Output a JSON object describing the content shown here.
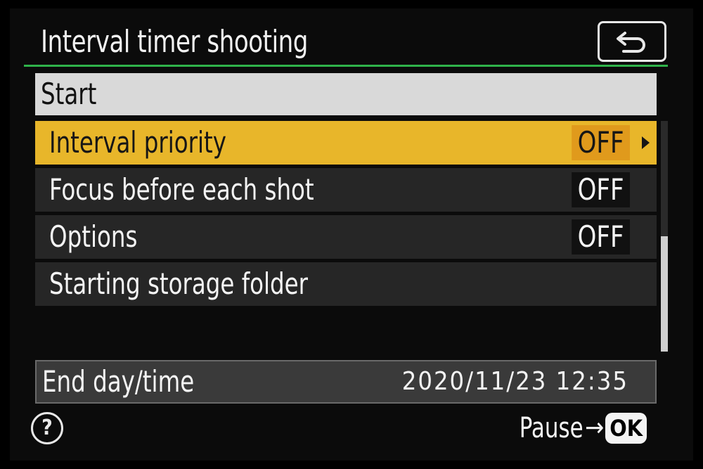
{
  "header": {
    "title": "Interval timer shooting",
    "back_icon": "return-arrow-icon"
  },
  "menu": {
    "start_label": "Start",
    "items": [
      {
        "label": "Interval priority",
        "value": "OFF",
        "selected": true
      },
      {
        "label": "Focus before each shot",
        "value": "OFF",
        "selected": false
      },
      {
        "label": "Options",
        "value": "OFF",
        "selected": false
      },
      {
        "label": "Starting storage folder",
        "value": "",
        "selected": false
      }
    ]
  },
  "end_time": {
    "label": "End day/time",
    "value": "2020/11/23  12:35"
  },
  "footer": {
    "help_icon": "?",
    "pause_label": "Pause",
    "arrow": "→",
    "ok_label": "OK"
  },
  "colors": {
    "highlight": "#e8b62a",
    "value_highlight": "#e09a1c",
    "title_rule": "#2fb24a",
    "row_bg": "#262626",
    "start_bg": "#d9d9d9"
  }
}
